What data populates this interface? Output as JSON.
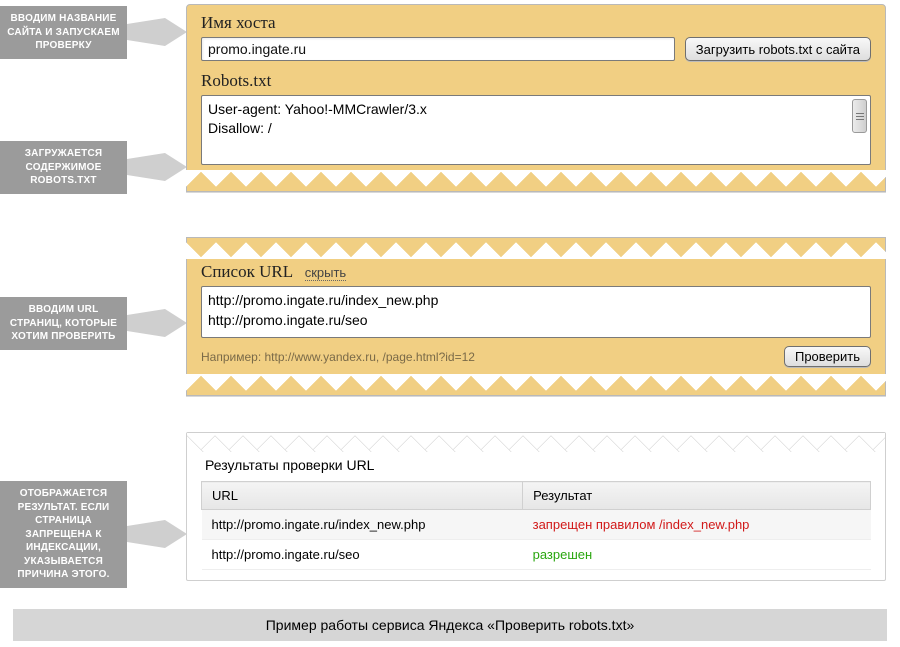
{
  "callouts": {
    "c1": "ВВОДИМ НАЗВАНИЕ САЙТА И ЗАПУСКАЕМ ПРОВЕРКУ",
    "c2": "ЗАГРУЖАЕТСЯ СОДЕРЖИМОЕ ROBOTS.TXT",
    "c3": "ВВОДИМ URL СТРАНИЦ, КОТОРЫЕ ХОТИМ ПРОВЕРИТЬ",
    "c4": "ОТОБРАЖАЕТСЯ РЕЗУЛЬТАТ. ЕСЛИ СТРАНИЦА ЗАПРЕЩЕНА К ИНДЕКСАЦИИ, УКАЗЫВАЕТСЯ ПРИЧИНА ЭТОГО."
  },
  "panelA": {
    "host_label": "Имя хоста",
    "host_value": "promo.ingate.ru",
    "load_button": "Загрузить robots.txt с сайта",
    "robots_label": "Robots.txt",
    "robots_line1": "User-agent: Yahoo!-MMCrawler/3.x",
    "robots_line2": "Disallow: /"
  },
  "panelB": {
    "list_label": "Список URL",
    "hide_link": "скрыть",
    "url_line1": "http://promo.ingate.ru/index_new.php",
    "url_line2": "http://promo.ingate.ru/seo",
    "example": "Например: http://www.yandex.ru, /page.html?id=12",
    "check_button": "Проверить"
  },
  "results": {
    "title": "Результаты проверки URL",
    "col_url": "URL",
    "col_result": "Результат",
    "rows": [
      {
        "url": "http://promo.ingate.ru/index_new.php",
        "status": "запрещен правилом /index_new.php",
        "cls": "denied"
      },
      {
        "url": "http://promo.ingate.ru/seo",
        "status": "разрешен",
        "cls": "allowed"
      }
    ]
  },
  "caption": "Пример работы сервиса Яндекса «Проверить robots.txt»"
}
